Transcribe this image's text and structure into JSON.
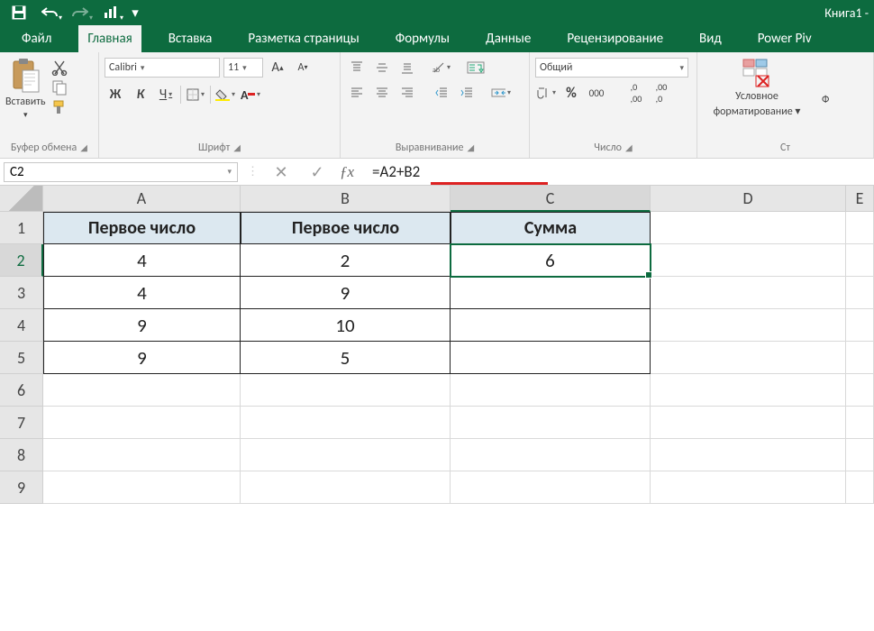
{
  "title": "Книга1 - ",
  "tabs": [
    "Файл",
    "Главная",
    "Вставка",
    "Разметка страницы",
    "Формулы",
    "Данные",
    "Рецензирование",
    "Вид",
    "Power Piv"
  ],
  "active_tab": "Главная",
  "ribbon": {
    "clipboard": {
      "paste": "Вставить",
      "label": "Буфер обмена"
    },
    "font": {
      "name": "Calibri",
      "size": "11",
      "label": "Шрифт",
      "bold": "Ж",
      "italic": "К",
      "underline": "Ч"
    },
    "alignment": {
      "label": "Выравнивание"
    },
    "number": {
      "format": "Общий",
      "label": "Число"
    },
    "styles": {
      "cond_fmt_1": "Условное",
      "cond_fmt_2": "форматирование",
      "label": "Ст",
      "extra": "Ф"
    }
  },
  "namebox": "C2",
  "formula": "=A2+B2",
  "columns": [
    "A",
    "B",
    "C",
    "D",
    "E"
  ],
  "rows": [
    "1",
    "2",
    "3",
    "4",
    "5",
    "6",
    "7",
    "8",
    "9"
  ],
  "sheet": {
    "headers": [
      "Первое число",
      "Первое число",
      "Сумма"
    ],
    "data": [
      [
        "4",
        "2",
        "6"
      ],
      [
        "4",
        "9",
        ""
      ],
      [
        "9",
        "10",
        ""
      ],
      [
        "9",
        "5",
        ""
      ]
    ]
  },
  "selected_cell": "C2"
}
